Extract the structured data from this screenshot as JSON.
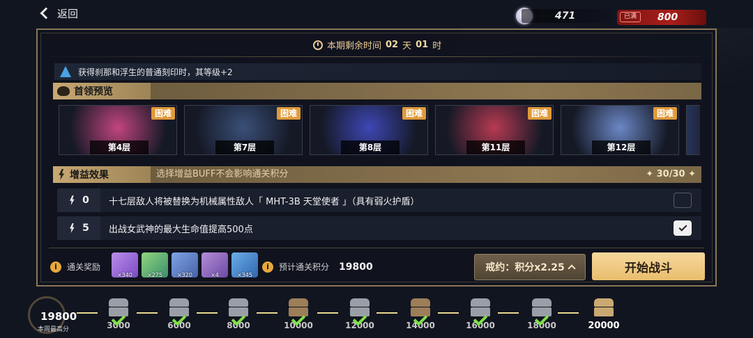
{
  "topbar": {
    "back_label": "返回"
  },
  "currency": {
    "crystal": "471",
    "badge_tag": "已满",
    "stamina": "800"
  },
  "timer": {
    "prefix": "本期剩余时间",
    "days": "02",
    "day_unit": "天",
    "hours": "01",
    "hour_unit": "时"
  },
  "tip": "获得刹那和浮生的普通刻印时，其等级+2",
  "boss_section": {
    "title": "首领预览",
    "cards": [
      {
        "tag": "困难",
        "floor": "第4层",
        "art": "#c2457f"
      },
      {
        "tag": "困难",
        "floor": "第7层",
        "art": "#3a4f78"
      },
      {
        "tag": "困难",
        "floor": "第8层",
        "art": "#3e47b5"
      },
      {
        "tag": "困难",
        "floor": "第11层",
        "art": "#b73a52"
      },
      {
        "tag": "困难",
        "floor": "第12层",
        "art": "#6b87c6"
      }
    ]
  },
  "buff_section": {
    "title": "增益效果",
    "subtitle": "选择增益BUFF不会影响通关积分",
    "count": "30/30",
    "rows": [
      {
        "cost": "0",
        "text": "十七层敌人将被替换为机械属性敌人「 MHT-3B 天堂使者 」（具有弱火护盾）",
        "checked": false
      },
      {
        "cost": "5",
        "text": "出战女武神的最大生命值提高500点",
        "checked": true
      }
    ]
  },
  "footer": {
    "reward_label": "通关奖励",
    "rewards": [
      "×340",
      "×275",
      "×320",
      "×4",
      "×345"
    ],
    "estimate_label": "预计通关积分",
    "estimate_value": "19800",
    "pact_label": "戒约：积分x2.25",
    "start_label": "开始战斗"
  },
  "progress": {
    "weekly_value": "19800",
    "weekly_label": "本周最高分",
    "nodes": [
      {
        "label": "3000",
        "chest": "gray",
        "done": true
      },
      {
        "label": "6000",
        "chest": "gray",
        "done": true
      },
      {
        "label": "8000",
        "chest": "gray",
        "done": true
      },
      {
        "label": "10000",
        "chest": "bronze",
        "done": true
      },
      {
        "label": "12000",
        "chest": "gray",
        "done": true
      },
      {
        "label": "14000",
        "chest": "bronze",
        "done": true
      },
      {
        "label": "16000",
        "chest": "gray",
        "done": true
      },
      {
        "label": "18000",
        "chest": "gray",
        "done": true
      },
      {
        "label": "20000",
        "chest": "gold",
        "done": false
      }
    ]
  }
}
